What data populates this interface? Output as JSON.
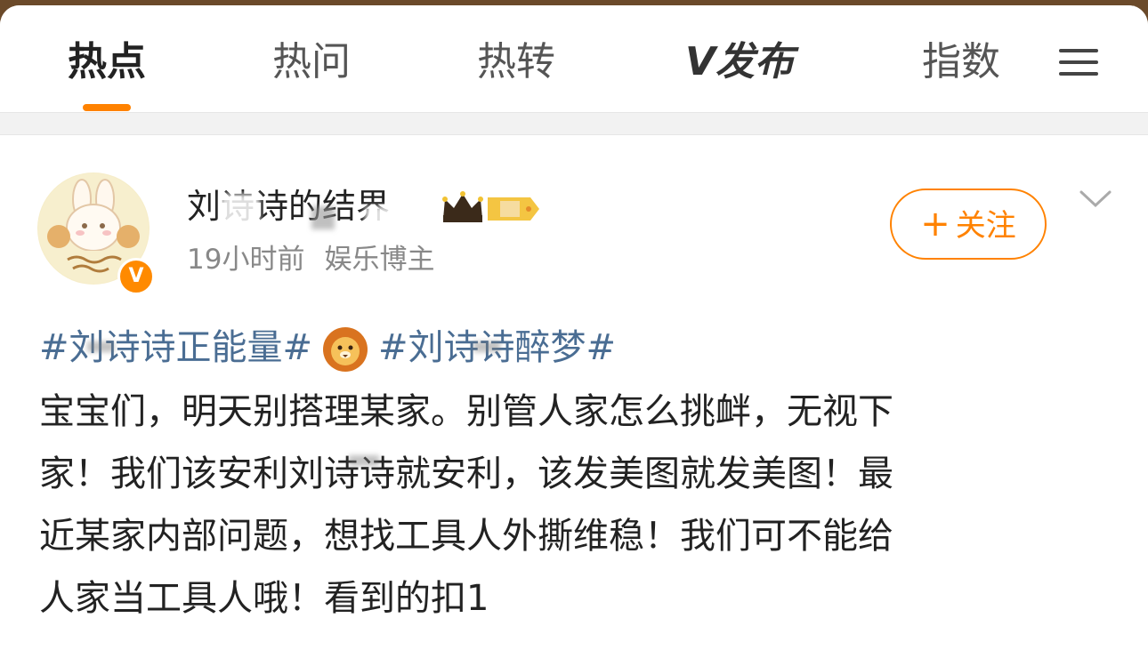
{
  "tabs": [
    {
      "label": "热点",
      "active": true
    },
    {
      "label": "热问",
      "active": false
    },
    {
      "label": "热转",
      "active": false
    },
    {
      "label": "V发布",
      "active": false
    },
    {
      "label": "指数",
      "active": false
    }
  ],
  "accent_color": "#ff8200",
  "link_color": "#4a6d93",
  "icons": {
    "menu": "hamburger-menu-icon",
    "chevron": "chevron-down-icon",
    "verified": "verified-v-icon",
    "lion": "lion-emoji-icon",
    "crown": "crown-icon"
  },
  "post": {
    "username": "刘诗诗的结界",
    "verified_mark": "V",
    "time": "19小时前",
    "role": "娱乐博主",
    "follow_label": "关注",
    "follow_plus": "+",
    "hashtag1": "#刘诗诗正能量#",
    "hashtag2": "#刘诗诗醉梦#",
    "lines": [
      "宝宝们，明天别搭理某家。别管人家怎么挑衅，无视下",
      "家！我们该安利刘诗诗就安利，该发美图就发美图！最",
      "近某家内部问题，想找工具人外撕维稳！我们可不能给",
      "人家当工具人哦！看到的扣1"
    ]
  }
}
